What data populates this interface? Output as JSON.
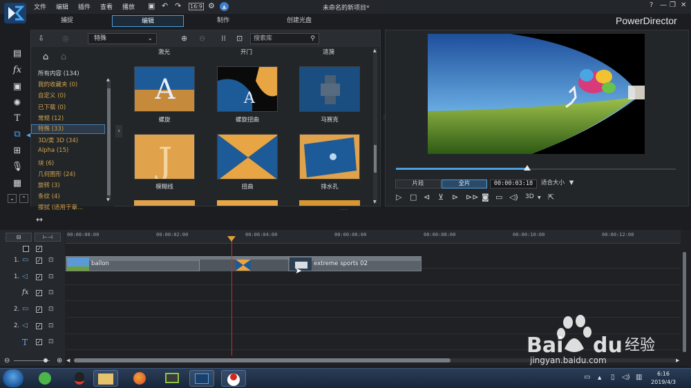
{
  "app": {
    "doc_title": "未命名的新项目*",
    "brand": "PowerDirector",
    "menu": [
      "文件",
      "编辑",
      "插件",
      "查看",
      "播放"
    ],
    "window_buttons": [
      "?",
      "—",
      "❐",
      "✕"
    ]
  },
  "mode_tabs": [
    {
      "label": "捕捉",
      "active": false
    },
    {
      "label": "编辑",
      "active": true
    },
    {
      "label": "制作",
      "active": false
    },
    {
      "label": "创建光盘",
      "active": false
    }
  ],
  "library": {
    "filter_select": "特殊",
    "search_placeholder": "搜索库",
    "categories": [
      {
        "label": "所有内容 (134)",
        "style": "white"
      },
      {
        "label": "我的收藏夹 (0)",
        "style": "gold"
      },
      {
        "label": "自定义 (0)",
        "style": "gold"
      },
      {
        "label": "已下载 (0)",
        "style": "gold"
      },
      {
        "label": "常规 (12)",
        "style": "gold"
      },
      {
        "label": "特殊 (33)",
        "style": "selected"
      },
      {
        "label": "3D/类 3D (34)",
        "style": "gold"
      },
      {
        "label": "Alpha (15)",
        "style": "gold"
      },
      {
        "label": "块 (6)",
        "style": "gold"
      },
      {
        "label": "几何图形 (24)",
        "style": "gold"
      },
      {
        "label": "旋转 (3)",
        "style": "gold"
      },
      {
        "label": "条纹 (4)",
        "style": "gold"
      },
      {
        "label": "擦拭 (适用于章...",
        "style": "gold"
      }
    ],
    "top_labels": [
      "激光",
      "开门",
      "涟漪"
    ],
    "transitions": [
      {
        "label": "螺旋"
      },
      {
        "label": "螺旋扭曲"
      },
      {
        "label": "马赛克"
      },
      {
        "label": "模糊线"
      },
      {
        "label": "扭曲"
      },
      {
        "label": "排水孔"
      }
    ]
  },
  "preview": {
    "clip_button": "片段",
    "full_button": "全片",
    "timecode": "00:00:03:18",
    "fit_label": "适合大小",
    "mode_3d": "3D",
    "progress": 0.47
  },
  "timeline": {
    "ruler_labels": [
      "00:00:00:00",
      "00:00:02:00",
      "00:00:04:00",
      "00:00:06:00",
      "00:00:08:00",
      "00:00:10:00",
      "00:00:12:00"
    ],
    "tracks": [
      {
        "label": "1.",
        "icon": "video"
      },
      {
        "label": "1.",
        "icon": "audio"
      },
      {
        "label": "",
        "icon": "fx"
      },
      {
        "label": "2.",
        "icon": "video"
      },
      {
        "label": "2.",
        "icon": "audio"
      },
      {
        "label": "",
        "icon": "title"
      }
    ],
    "clips": [
      {
        "name": "ballon"
      },
      {
        "name": "extreme sports 02"
      }
    ]
  },
  "taskbar": {
    "time": "6:16",
    "date": "2019/4/3"
  },
  "watermark": {
    "text": "jingyan.baidu.com"
  }
}
